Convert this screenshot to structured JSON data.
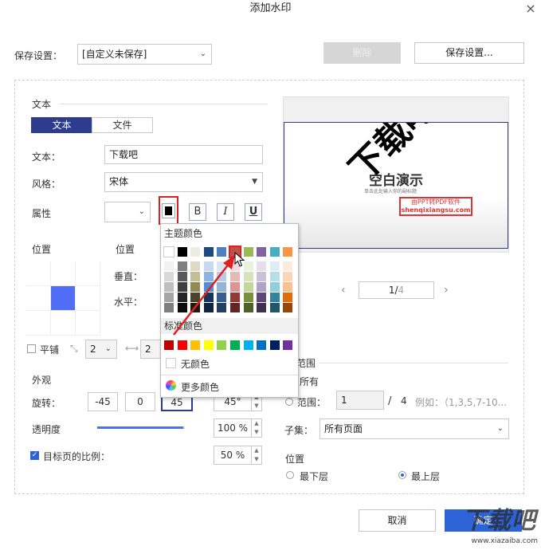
{
  "dialog": {
    "title": "添加水印",
    "close": "×"
  },
  "top": {
    "save_settings_label": "保存设置：",
    "save_settings_value": "[自定义未保存]",
    "delete_label": "删除",
    "save_button_label": "保存设置..."
  },
  "text_section": {
    "heading": "文本",
    "tab_text": "文本",
    "tab_file": "文件",
    "text_label": "文本：",
    "text_value": "下载吧",
    "style_label": "风格：",
    "style_value": "宋体",
    "attr_label": "属性",
    "bold": "B",
    "italic": "I",
    "underline": "U"
  },
  "position": {
    "label_left": "位置",
    "label_right": "位置",
    "vertical_label": "垂直：",
    "horizontal_label": "水平：",
    "tile_label": "平铺",
    "tile_value_1": "2",
    "tile_value_2": "2"
  },
  "appearance": {
    "heading": "外观",
    "rotate_label": "旋转：",
    "rot_values": [
      "-45",
      "0",
      "45"
    ],
    "rot_custom": "45°",
    "opacity_label": "透明度",
    "opacity_value": "100 %",
    "opacity_level": 0.98,
    "scale_label": "目标页的比例：",
    "scale_value": "50 %"
  },
  "preview": {
    "watermark": "下载吧",
    "doc_text": "空白演示",
    "doc_sub": "单击此处输入你的副标题",
    "badge": "由PPT转PDF软件",
    "url": "shenqixiangsu.com",
    "page_current": "1/",
    "page_total": "4",
    "prev": "‹",
    "next": "›"
  },
  "range": {
    "heading": "范围",
    "all_label": "所有",
    "range_label": "范围：",
    "range_from": "1",
    "range_sep": "/",
    "range_total": "4",
    "range_example": "例如：（1,3,5,7-10...",
    "subset_label": "子集：",
    "subset_value": "所有页面"
  },
  "layer": {
    "heading": "位置",
    "bottom_label": "最下层",
    "top_label": "最上层"
  },
  "color_popup": {
    "theme_heading": "主题颜色",
    "standard_heading": "标准颜色",
    "no_color": "无颜色",
    "more_colors": "更多颜色",
    "theme_top": [
      "#ffffff",
      "#000000",
      "#eeece1",
      "#1f497d",
      "#4f81bd",
      "#c0504d",
      "#9bbb59",
      "#8064a2",
      "#4bacc6",
      "#f79646"
    ],
    "theme_shades": [
      [
        "#f2f2f2",
        "#7f7f7f",
        "#ddd9c3",
        "#c6d9f0",
        "#dbe5f1",
        "#f2dcdb",
        "#ebf1dd",
        "#e5e0ec",
        "#dbeef3",
        "#fdeada"
      ],
      [
        "#d8d8d8",
        "#595959",
        "#c4bd97",
        "#8db3e2",
        "#b8cce4",
        "#e5b9b7",
        "#d7e3bc",
        "#ccc1d9",
        "#b7dde8",
        "#fbd5b5"
      ],
      [
        "#bfbfbf",
        "#3f3f3f",
        "#938953",
        "#548dd4",
        "#95b3d7",
        "#d99694",
        "#c3d69b",
        "#b2a2c7",
        "#92cddc",
        "#fac08f"
      ],
      [
        "#a5a5a5",
        "#262626",
        "#494429",
        "#17365d",
        "#366092",
        "#953734",
        "#76923c",
        "#5f497a",
        "#31859b",
        "#e36c09"
      ],
      [
        "#7f7f7f",
        "#0c0c0c",
        "#1d1b10",
        "#0f243e",
        "#244061",
        "#632423",
        "#4f6128",
        "#3f3151",
        "#205867",
        "#974806"
      ]
    ],
    "standard": [
      "#c00000",
      "#ff0000",
      "#ffc000",
      "#ffff00",
      "#92d050",
      "#00b050",
      "#00b0f0",
      "#0070c0",
      "#002060",
      "#7030a0"
    ]
  },
  "current_color": "#000000",
  "footer": {
    "cancel": "取消",
    "ok": "确定"
  },
  "brand_watermark": "下载吧",
  "brand_url": "www.xiazaiba.com"
}
